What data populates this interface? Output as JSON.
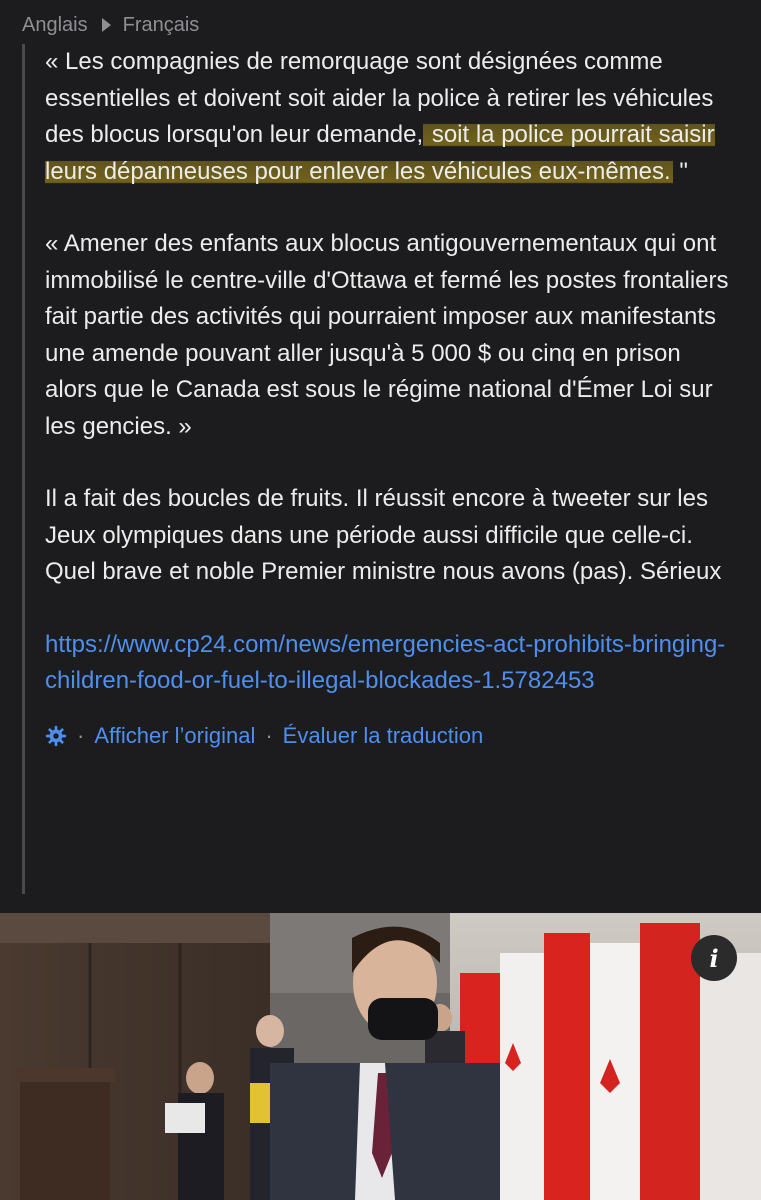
{
  "header": {
    "source_lang": "Anglais",
    "target_lang": "Français"
  },
  "translation": {
    "p1_before": "« Les compagnies de remorquage sont désignées comme essentielles et doivent soit aider la police à retirer les véhicules des blocus lorsqu'on leur demande,",
    "p1_highlight": " soit la police pourrait saisir leurs dépanneuses pour enlever les véhicules eux-mêmes.",
    "p1_after": " \"",
    "p2": "« Amener des enfants aux blocus antigouvernementaux qui ont immobilisé le centre-ville d'Ottawa et fermé les postes frontaliers fait partie des activités qui pourraient imposer aux manifestants une amende pouvant aller jusqu'à 5 000 $ ou cinq en prison alors que le Canada est sous le régime national d'Émer Loi sur les gencies. »",
    "p3": "Il a fait des boucles de fruits. Il réussit encore à tweeter sur les Jeux olympiques dans une période aussi difficile que celle-ci. Quel brave et noble Premier ministre nous avons (pas). Sérieux",
    "link": "https://www.cp24.com/news/emergencies-act-prohibits-bringing-children-food-or-fuel-to-illegal-blockades-1.5782453"
  },
  "actions": {
    "gear_icon": "gear-icon",
    "show_original": "Afficher l’original",
    "rate_translation": "Évaluer la traduction",
    "separator": "·"
  },
  "photo": {
    "info_label": "i"
  },
  "colors": {
    "background": "#1c1c1e",
    "link": "#4d8ff0",
    "highlight": "#a8912a"
  }
}
